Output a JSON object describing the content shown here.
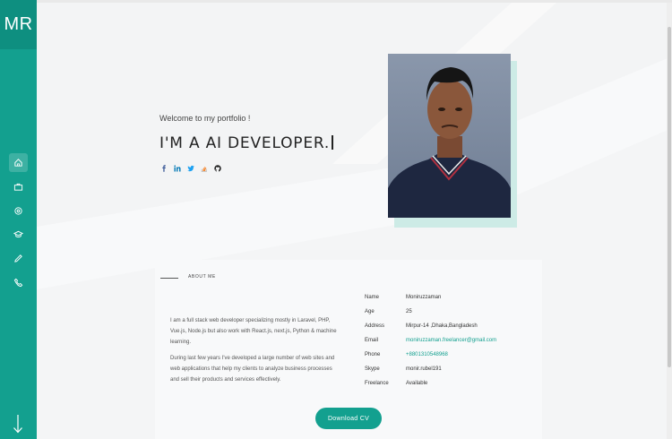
{
  "sidebar": {
    "logo": "MR",
    "nav": [
      {
        "icon": "home-icon",
        "label": "Home",
        "active": true
      },
      {
        "icon": "briefcase-icon",
        "label": "Portfolio"
      },
      {
        "icon": "gear-icon",
        "label": "Services"
      },
      {
        "icon": "graduation-cap-icon",
        "label": "Education"
      },
      {
        "icon": "pencil-icon",
        "label": "Blog"
      },
      {
        "icon": "phone-icon",
        "label": "Contact"
      }
    ],
    "scroll_icon": "arrow-down-icon"
  },
  "hero": {
    "greeting": "Welcome to my portfolio !",
    "title": "I'M A AI DEVELOPER.",
    "social": [
      {
        "icon": "facebook-icon",
        "color": "#3b5998"
      },
      {
        "icon": "linkedin-icon",
        "color": "#0077b5"
      },
      {
        "icon": "twitter-icon",
        "color": "#1da1f2"
      },
      {
        "icon": "stackoverflow-icon",
        "color": "#f48024"
      },
      {
        "icon": "github-icon",
        "color": "#222222"
      }
    ]
  },
  "about": {
    "label": "ABOUT ME",
    "bio": [
      "I am a full stack web developer specializing mostly in Laravel, PHP, Vue.js, Node.js but also work with React.js, next.js, Python & machine learning.",
      "During last few years I've developed a large number of web sites and web applications that help my clients to analyze business processes and sell their products and services effectively."
    ],
    "info": [
      {
        "key": "Name",
        "value": "Moniruzzaman"
      },
      {
        "key": "Age",
        "value": "25"
      },
      {
        "key": "Address",
        "value": "Mirpur-14 ,Dhaka,Bangladesh"
      },
      {
        "key": "Email",
        "value": "moniruzzaman.freelancer@gmail.com"
      },
      {
        "key": "Phone",
        "value": "+8801310548968"
      },
      {
        "key": "Skype",
        "value": "monir.rubel191"
      },
      {
        "key": "Freelance",
        "value": "Available"
      }
    ],
    "cv_button": "Download CV"
  },
  "colors": {
    "accent": "#13a08f",
    "accent_dark": "#0e8f80"
  }
}
